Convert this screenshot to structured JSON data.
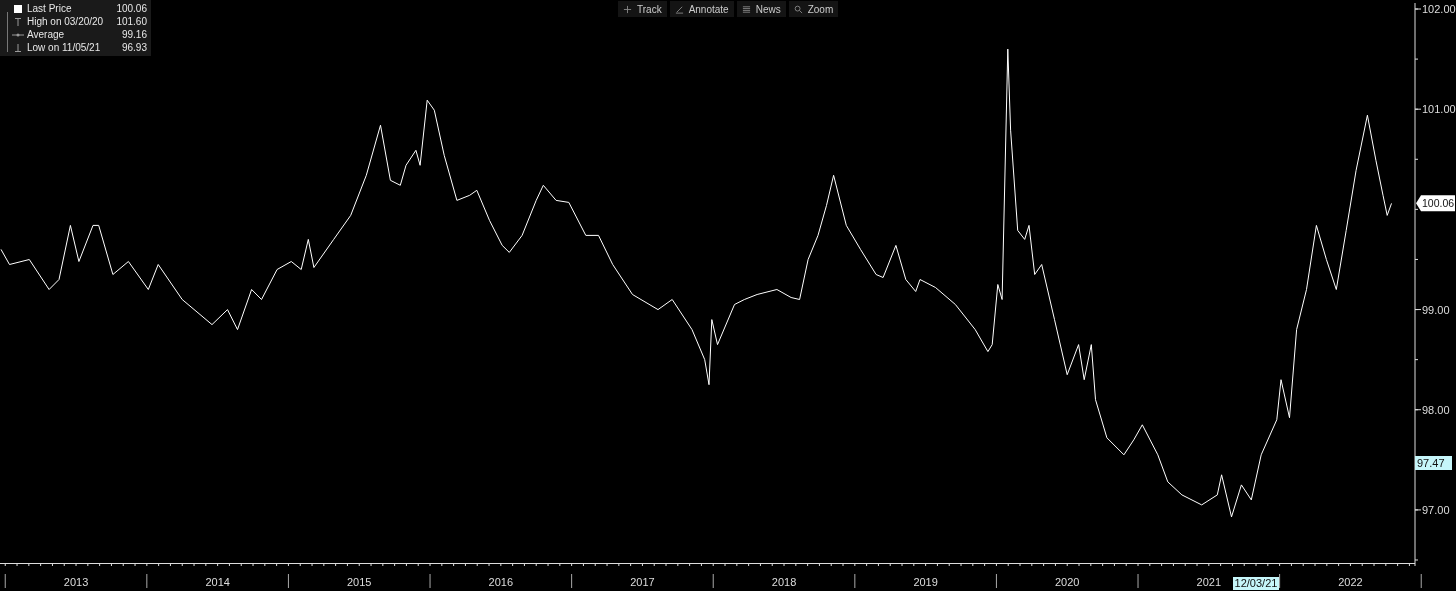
{
  "legend": [
    {
      "kind": "last",
      "value": "100.06"
    },
    {
      "kind": "high",
      "label": "High on 03/20/20",
      "value": "101.60"
    },
    {
      "kind": "average",
      "label": "Average",
      "value": "99.16"
    },
    {
      "kind": "low",
      "label": "Low on 11/05/21",
      "value": "96.93"
    }
  ],
  "toolbar": [
    {
      "kind": "track",
      "label": "Track"
    },
    {
      "kind": "annotate",
      "label": "Annotate"
    },
    {
      "kind": "news",
      "label": "News"
    },
    {
      "kind": "zoom",
      "label": "Zoom"
    }
  ],
  "chart_data": {
    "type": "line",
    "x": [
      2012.97,
      2013.03,
      2013.17,
      2013.31,
      2013.38,
      2013.46,
      2013.52,
      2013.62,
      2013.66,
      2013.76,
      2013.87,
      2014.01,
      2014.08,
      2014.25,
      2014.46,
      2014.57,
      2014.64,
      2014.74,
      2014.81,
      2014.92,
      2015.02,
      2015.09,
      2015.14,
      2015.18,
      2015.32,
      2015.44,
      2015.55,
      2015.65,
      2015.72,
      2015.79,
      2015.83,
      2015.9,
      2015.93,
      2015.98,
      2016.03,
      2016.1,
      2016.19,
      2016.28,
      2016.33,
      2016.42,
      2016.51,
      2016.56,
      2016.65,
      2016.75,
      2016.8,
      2016.89,
      2016.98,
      2017.1,
      2017.19,
      2017.29,
      2017.43,
      2017.61,
      2017.71,
      2017.85,
      2017.94,
      2017.97,
      2017.99,
      2018.03,
      2018.15,
      2018.22,
      2018.31,
      2018.45,
      2018.55,
      2018.61,
      2018.67,
      2018.74,
      2018.8,
      2018.85,
      2018.94,
      2019.04,
      2019.15,
      2019.2,
      2019.29,
      2019.36,
      2019.43,
      2019.46,
      2019.57,
      2019.71,
      2019.85,
      2019.94,
      2019.97,
      2020.01,
      2020.04,
      2020.08,
      2020.1,
      2020.15,
      2020.2,
      2020.23,
      2020.27,
      2020.32,
      2020.41,
      2020.5,
      2020.58,
      2020.62,
      2020.67,
      2020.7,
      2020.78,
      2020.9,
      2020.97,
      2021.03,
      2021.14,
      2021.21,
      2021.31,
      2021.45,
      2021.56,
      2021.59,
      2021.66,
      2021.73,
      2021.8,
      2021.87,
      2021.98,
      2022.01,
      2022.07,
      2022.12,
      2022.19,
      2022.26,
      2022.33,
      2022.4,
      2022.47,
      2022.54,
      2022.62,
      2022.68,
      2022.73,
      2022.76,
      2022.79
    ],
    "series": [
      {
        "name": "Last Price",
        "color": "#ffffff",
        "values": [
          99.6,
          99.45,
          99.5,
          99.2,
          99.3,
          99.84,
          99.48,
          99.84,
          99.84,
          99.35,
          99.48,
          99.2,
          99.45,
          99.1,
          98.85,
          99.0,
          98.8,
          99.2,
          99.1,
          99.4,
          99.48,
          99.4,
          99.7,
          99.42,
          99.7,
          99.94,
          100.34,
          100.84,
          100.29,
          100.24,
          100.44,
          100.59,
          100.44,
          101.09,
          100.99,
          100.54,
          100.09,
          100.14,
          100.19,
          99.89,
          99.64,
          99.57,
          99.74,
          100.09,
          100.24,
          100.09,
          100.07,
          99.74,
          99.74,
          99.45,
          99.15,
          99.0,
          99.1,
          98.8,
          98.5,
          98.25,
          98.9,
          98.65,
          99.05,
          99.1,
          99.15,
          99.2,
          99.12,
          99.1,
          99.5,
          99.74,
          100.04,
          100.34,
          99.84,
          99.6,
          99.35,
          99.32,
          99.64,
          99.3,
          99.18,
          99.3,
          99.22,
          99.05,
          98.8,
          98.58,
          98.65,
          99.25,
          99.1,
          101.6,
          100.79,
          99.79,
          99.7,
          99.84,
          99.35,
          99.45,
          98.9,
          98.35,
          98.65,
          98.3,
          98.65,
          98.1,
          97.72,
          97.55,
          97.7,
          97.85,
          97.55,
          97.28,
          97.15,
          97.05,
          97.15,
          97.35,
          96.93,
          97.25,
          97.1,
          97.55,
          97.9,
          98.3,
          97.92,
          98.8,
          99.2,
          99.84,
          99.5,
          99.2,
          99.79,
          100.39,
          100.94,
          100.49,
          100.14,
          99.94,
          100.06
        ]
      }
    ],
    "xlim": [
      2012.963,
      2022.949
    ],
    "ylim": [
      96.48,
      102.09
    ],
    "xticks": [
      {
        "value": 2013.5,
        "label": "2013"
      },
      {
        "value": 2014.5,
        "label": "2014"
      },
      {
        "value": 2015.5,
        "label": "2015"
      },
      {
        "value": 2016.5,
        "label": "2016"
      },
      {
        "value": 2017.5,
        "label": "2017"
      },
      {
        "value": 2018.5,
        "label": "2018"
      },
      {
        "value": 2019.5,
        "label": "2019"
      },
      {
        "value": 2020.5,
        "label": "2020"
      },
      {
        "value": 2021.5,
        "label": "2021"
      },
      {
        "value": 2022.5,
        "label": "2022"
      }
    ],
    "yticks": [
      {
        "value": 97,
        "label": "97.00"
      },
      {
        "value": 98,
        "label": "98.00"
      },
      {
        "value": 99,
        "label": "99.00"
      },
      {
        "value": 101,
        "label": "101.00"
      },
      {
        "value": 102,
        "label": "102.00"
      }
    ]
  },
  "last_price_tag": "100.06",
  "crosshair_value_tag": "97.47",
  "crosshair_date_tag": "12/03/21"
}
